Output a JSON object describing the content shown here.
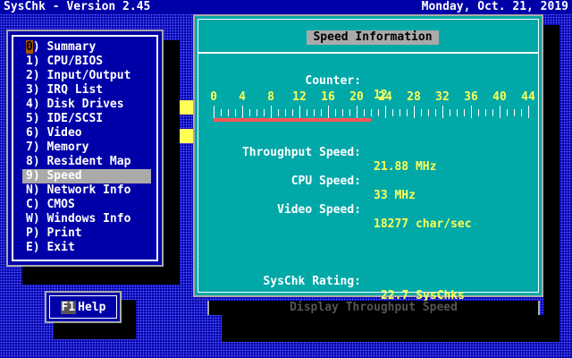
{
  "titlebar": {
    "app": "SysChk - Version 2.45",
    "date": "Monday, Oct. 21, 2019"
  },
  "menu": {
    "items": [
      {
        "key": "0",
        "label": ") Summary"
      },
      {
        "key": "1",
        "label": ") CPU/BIOS"
      },
      {
        "key": "2",
        "label": ") Input/Output"
      },
      {
        "key": "3",
        "label": ") IRQ List"
      },
      {
        "key": "4",
        "label": ") Disk Drives"
      },
      {
        "key": "5",
        "label": ") IDE/SCSI"
      },
      {
        "key": "6",
        "label": ") Video"
      },
      {
        "key": "7",
        "label": ") Memory"
      },
      {
        "key": "8",
        "label": ") Resident Map"
      },
      {
        "key": "9",
        "label": ") Speed"
      },
      {
        "key": "N",
        "label": ") Network Info"
      },
      {
        "key": "C",
        "label": ") CMOS"
      },
      {
        "key": "W",
        "label": ") Windows Info"
      },
      {
        "key": "P",
        "label": ") Print"
      },
      {
        "key": "E",
        "label": ") Exit"
      }
    ],
    "selected_index": 9
  },
  "help": {
    "key": "F1",
    "label": "Help"
  },
  "speed": {
    "title": "Speed Information",
    "counter_label": "Counter:",
    "counter_value": "12",
    "scale_labels": [
      "0",
      "4",
      "8",
      "12",
      "16",
      "20",
      "24",
      "28",
      "32",
      "36",
      "40",
      "44"
    ],
    "scale_max": 44,
    "scale_fill": 22,
    "throughput_label": "Throughput Speed:",
    "throughput_value": "21.88 MHz",
    "cpu_label": "CPU Speed:",
    "cpu_value": "33 MHz",
    "video_label": "Video Speed:",
    "video_value": "18277 char/sec",
    "rating_label": "SysChk Rating:",
    "rating_value": "22.7 SysChks"
  },
  "status": {
    "text": "Display Throughput Speed"
  },
  "colors": {
    "background": "#0000a8",
    "panel": "#00a8a8",
    "value_text": "#ffff55",
    "bar_fill": "#ff5555",
    "selection": "#aaaaaa"
  }
}
